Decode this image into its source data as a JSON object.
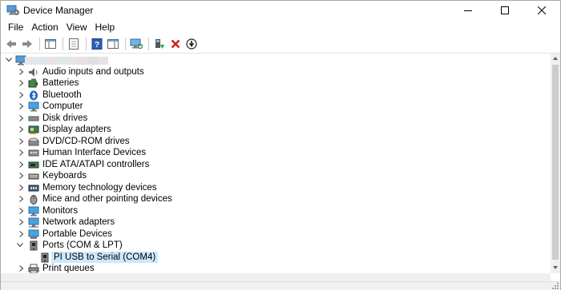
{
  "window": {
    "title": "Device Manager",
    "controls": [
      "minimize-icon",
      "maximize-icon",
      "close-icon"
    ]
  },
  "menu": [
    "File",
    "Action",
    "View",
    "Help"
  ],
  "toolbar": [
    "back-arrow-icon",
    "forward-arrow-icon",
    "show-hide-console-tree-icon",
    "properties-icon",
    "help-icon",
    "show-action-pane-icon",
    "scan-hardware-changes-icon",
    "update-driver-icon",
    "uninstall-device-icon",
    "disable-device-icon"
  ],
  "tree": {
    "root_label": "",
    "items": [
      {
        "label": "Audio inputs and outputs",
        "icon": "speaker-icon",
        "expanded": false
      },
      {
        "label": "Batteries",
        "icon": "battery-icon",
        "expanded": false
      },
      {
        "label": "Bluetooth",
        "icon": "bluetooth-icon",
        "expanded": false
      },
      {
        "label": "Computer",
        "icon": "monitor-icon",
        "expanded": false
      },
      {
        "label": "Disk drives",
        "icon": "disk-drive-icon",
        "expanded": false
      },
      {
        "label": "Display adapters",
        "icon": "display-adapter-icon",
        "expanded": false
      },
      {
        "label": "DVD/CD-ROM drives",
        "icon": "dvd-drive-icon",
        "expanded": false
      },
      {
        "label": "Human Interface Devices",
        "icon": "hid-icon",
        "expanded": false
      },
      {
        "label": "IDE ATA/ATAPI controllers",
        "icon": "ide-controller-icon",
        "expanded": false
      },
      {
        "label": "Keyboards",
        "icon": "keyboard-icon",
        "expanded": false
      },
      {
        "label": "Memory technology devices",
        "icon": "memory-icon",
        "expanded": false
      },
      {
        "label": "Mice and other pointing devices",
        "icon": "mouse-icon",
        "expanded": false
      },
      {
        "label": "Monitors",
        "icon": "monitor-icon",
        "expanded": false
      },
      {
        "label": "Network adapters",
        "icon": "network-adapter-icon",
        "expanded": false
      },
      {
        "label": "Portable Devices",
        "icon": "portable-device-icon",
        "expanded": false
      },
      {
        "label": "Ports (COM & LPT)",
        "icon": "port-icon",
        "expanded": true,
        "children": [
          {
            "label": "PI USB to Serial (COM4)",
            "icon": "port-icon",
            "selected": true
          }
        ]
      },
      {
        "label": "Print queues",
        "icon": "printer-icon",
        "expanded": false
      }
    ]
  },
  "colors": {
    "selection": "#cce8ff",
    "scrollbar_track": "#f0f0f0",
    "scrollbar_thumb": "#cdcdcd"
  }
}
